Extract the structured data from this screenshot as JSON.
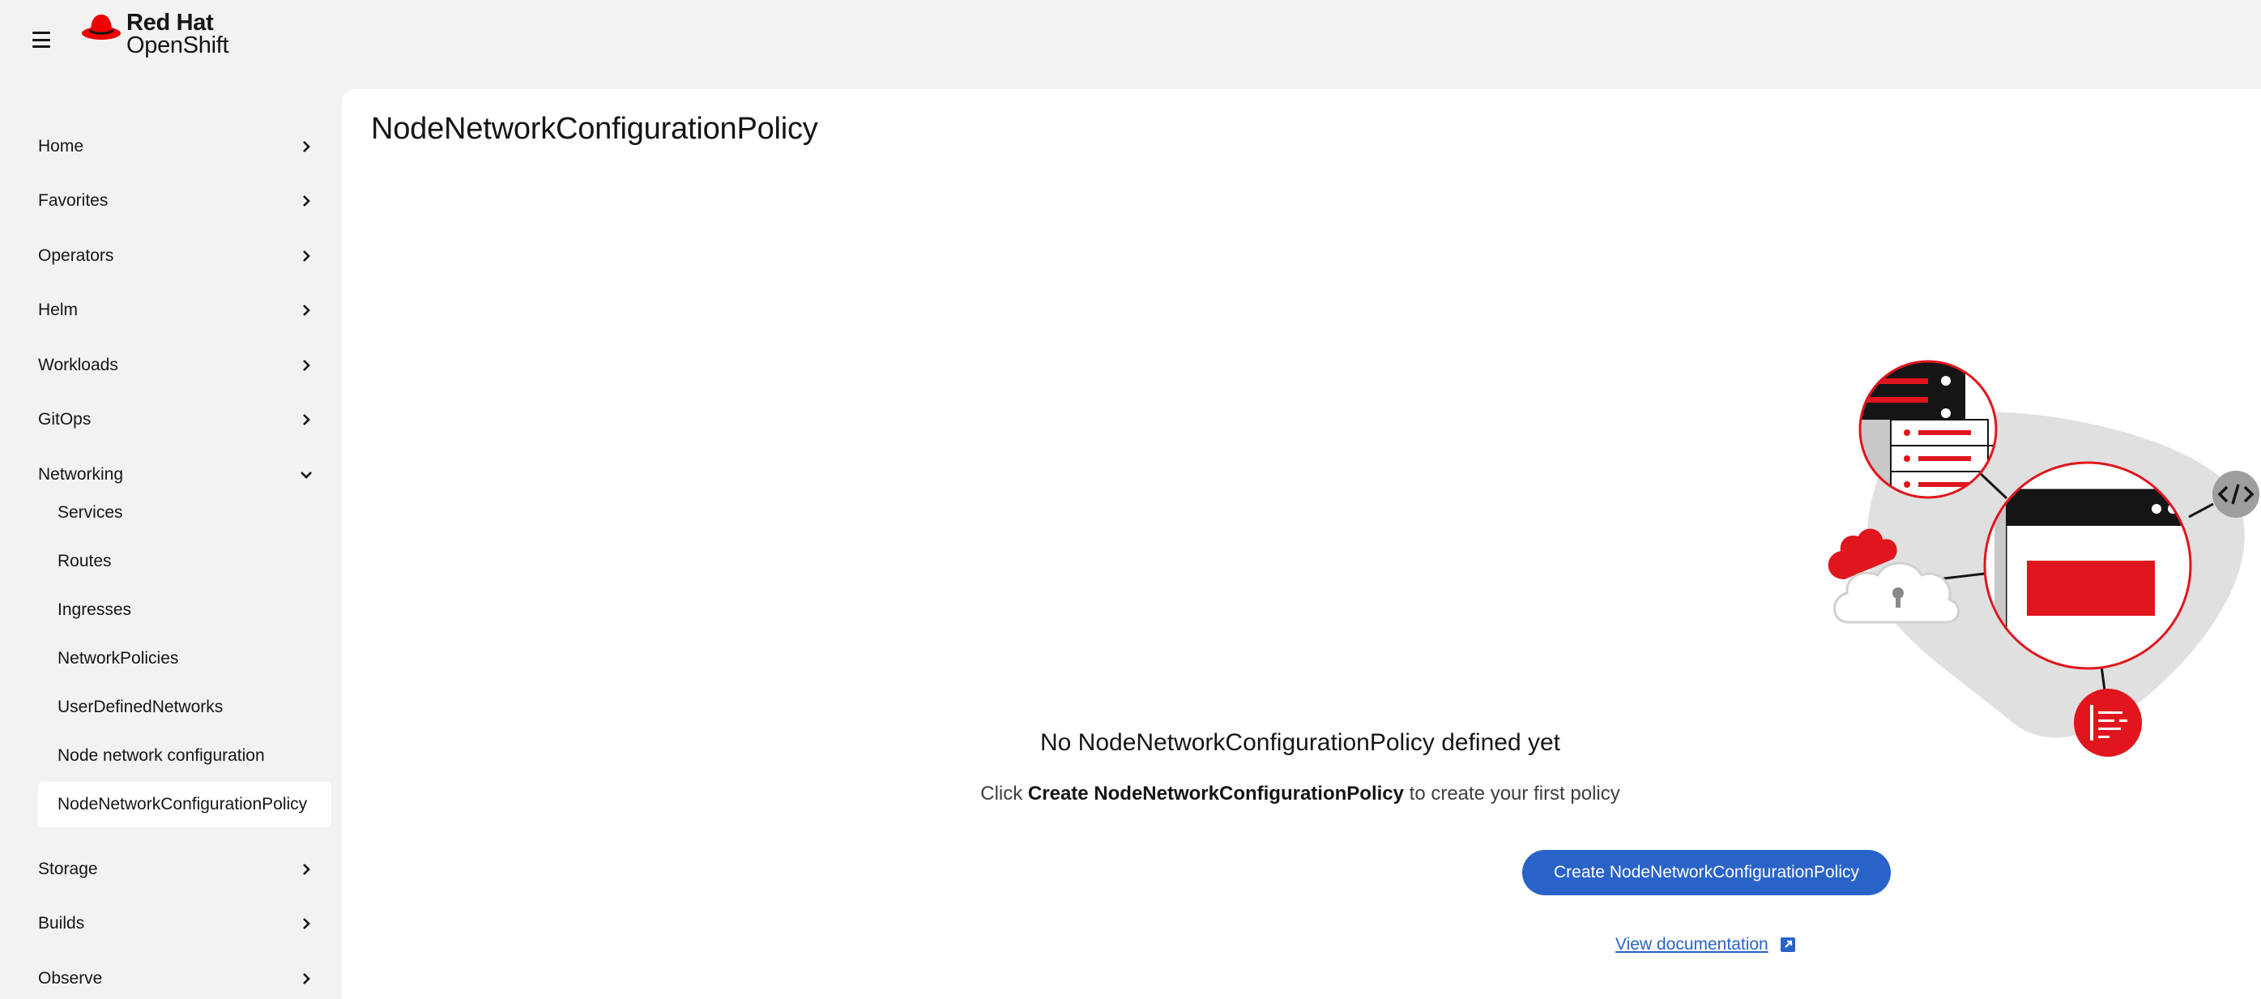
{
  "brand": {
    "line1": "Red Hat",
    "line2": "OpenShift",
    "accent_color": "#ee0000"
  },
  "sidebar": {
    "items": [
      {
        "label": "Home",
        "expanded": false
      },
      {
        "label": "Favorites",
        "expanded": false
      },
      {
        "label": "Operators",
        "expanded": false
      },
      {
        "label": "Helm",
        "expanded": false
      },
      {
        "label": "Workloads",
        "expanded": false
      },
      {
        "label": "GitOps",
        "expanded": false
      },
      {
        "label": "Networking",
        "expanded": true
      },
      {
        "label": "Storage",
        "expanded": false
      },
      {
        "label": "Builds",
        "expanded": false
      },
      {
        "label": "Observe",
        "expanded": false
      }
    ],
    "networking_children": [
      {
        "label": "Services"
      },
      {
        "label": "Routes"
      },
      {
        "label": "Ingresses"
      },
      {
        "label": "NetworkPolicies"
      },
      {
        "label": "UserDefinedNetworks"
      },
      {
        "label": "Node network configuration"
      },
      {
        "label": "NodeNetworkConfigurationPolicy",
        "active": true
      }
    ]
  },
  "main": {
    "page_title": "NodeNetworkConfigurationPolicy",
    "empty_state": {
      "title": "No NodeNetworkConfigurationPolicy defined yet",
      "body_prefix": "Click ",
      "body_bold": "Create NodeNetworkConfigurationPolicy",
      "body_suffix": " to create your first policy",
      "create_button": "Create NodeNetworkConfigurationPolicy",
      "doc_link": "View documentation"
    }
  },
  "colors": {
    "primary_button": "#2a63c8",
    "illustration_red": "#e0151d",
    "sidebar_bg": "#f2f2f2"
  }
}
